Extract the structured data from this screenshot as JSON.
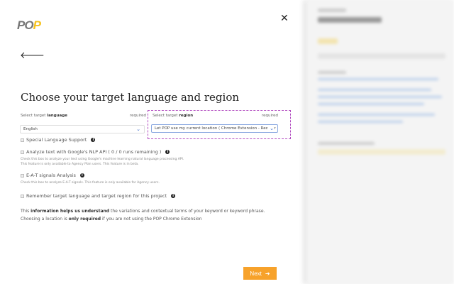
{
  "logo": "POP",
  "title": "Choose your target language and region",
  "language": {
    "label_prefix": "Select target ",
    "label_bold": "language",
    "required": "required",
    "value": "English"
  },
  "region": {
    "label_prefix": "Select target ",
    "label_bold": "region",
    "required": "required",
    "value": "Let POP use my current location ( Chrome Extension - Recomr"
  },
  "options": {
    "special": "Special Language Support",
    "nlp": "Analyze text with Google's NLP API ( 0 / 0 runs remaining )",
    "nlp_help1": "Check this box to analyze your text using Google's machine learning natural language processing API.",
    "nlp_help2": "This feature is only available to Agency Plan users. This feature is in beta.",
    "eat": "E-A-T signals Analysis",
    "eat_help": "Check this box to analyze E-A-T signals. This feature is only available for Agency users.",
    "remember": "Remember target language and target region for this project"
  },
  "info": {
    "l1a": "This ",
    "l1b": "information helps us understand",
    "l1c": " the variations and contextual terms of your keyword or keyword phrase.",
    "l2a": "Choosing a location is ",
    "l2b": "only required",
    "l2c": " if you are not using the POP Chrome Extension"
  },
  "next": "Next",
  "colors": {
    "accent": "#f7a22b",
    "region_border": "#b24bc0"
  }
}
